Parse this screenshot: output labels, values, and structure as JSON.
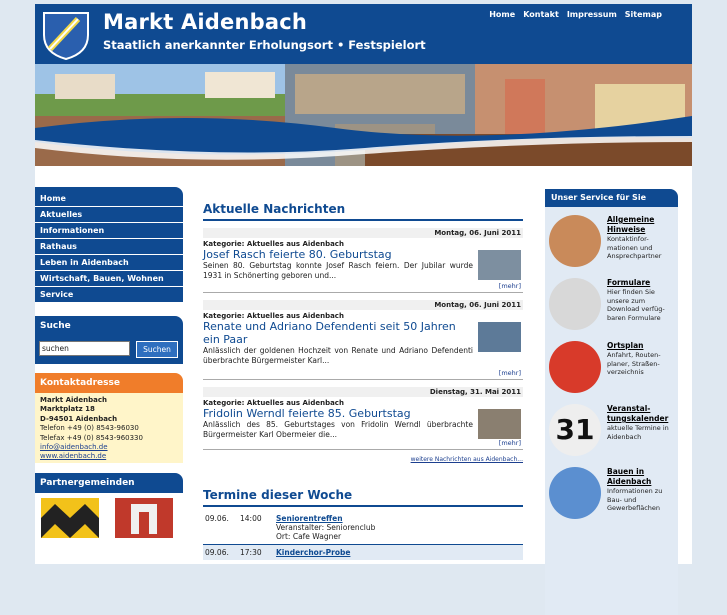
{
  "header": {
    "title": "Markt Aidenbach",
    "subtitle": "Staatlich anerkannter Erholungsort • Festspielort",
    "nav": [
      "Home",
      "Kontakt",
      "Impressum",
      "Sitemap"
    ]
  },
  "menu": [
    "Home",
    "Aktuelles",
    "Informationen",
    "Rathaus",
    "Leben in Aidenbach",
    "Wirtschaft, Bauen, Wohnen",
    "Service"
  ],
  "search": {
    "title": "Suche",
    "value": "suchen",
    "button": "Suchen"
  },
  "contact": {
    "title": "Kontaktadresse",
    "lines": [
      "Markt Aidenbach",
      "Marktplatz 18",
      "D-94501 Aidenbach",
      "Telefon +49 (0) 8543-96030",
      "Telefax +49 (0) 8543-960330"
    ],
    "email": "info@aidenbach.de",
    "web": "www.aidenbach.de"
  },
  "partner": {
    "title": "Partnergemeinden"
  },
  "news": {
    "section_title": "Aktuelle Nachrichten",
    "items": [
      {
        "date": "Montag, 06. Juni 2011",
        "category": "Kategorie: Aktuelles aus Aidenbach",
        "title": "Josef Rasch feierte 80. Geburtstag",
        "text": "Seinen 80. Geburtstag konnte Josef Rasch feiern. Der Jubilar wurde 1931 in Schönerting geboren und...",
        "more": "[mehr]"
      },
      {
        "date": "Montag, 06. Juni 2011",
        "category": "Kategorie: Aktuelles aus Aidenbach",
        "title": "Renate und Adriano Defendenti seit 50 Jahren ein Paar",
        "text": "Anlässlich der goldenen Hochzeit von Renate und Adriano Defendenti überbrachte Bürgermeister Karl...",
        "more": "[mehr]"
      },
      {
        "date": "Dienstag, 31. Mai 2011",
        "category": "Kategorie: Aktuelles aus Aidenbach",
        "title": "Fridolin Werndl feierte 85. Geburtstag",
        "text": "Anlässlich des 85. Geburtstages von Fridolin Werndl überbrachte Bürgermeister Karl Obermeier die...",
        "more": "[mehr]"
      }
    ],
    "more_link": "weitere Nachrichten aus Aidenbach..."
  },
  "events": {
    "section_title": "Termine dieser Woche",
    "items": [
      {
        "date": "09.06.",
        "time": "14:00",
        "title": "Seniorentreffen",
        "organizer": "Veranstalter: Seniorenclub",
        "place": "Ort: Cafe Wagner"
      },
      {
        "date": "09.06.",
        "time": "17:30",
        "title": "Kinderchor-Probe"
      }
    ]
  },
  "service": {
    "title": "Unser Service für Sie",
    "items": [
      {
        "title": "Allgemeine Hinweise",
        "desc": "Kontaktinfor-mationen und Ansprechpartner",
        "color": "#c98a5a"
      },
      {
        "title": "Formulare",
        "desc": "Hier finden Sie unsere zum Download verfüg-baren Formulare",
        "color": "#d8d8d8"
      },
      {
        "title": "Ortsplan",
        "desc": "Anfahrt, Routen-planer, Straßen-verzeichnis",
        "color": "#d83a2a"
      },
      {
        "title": "Veranstal-tungskalender",
        "desc": "aktuelle Termine in Aidenbach",
        "color": "#444444"
      },
      {
        "title": "Bauen in Aidenbach",
        "desc": "Informationen zu Bau- und Gewerbeflächen",
        "color": "#5b8fd0"
      }
    ]
  },
  "colors": {
    "brand": "#0f4a91",
    "accent": "#f07d2a",
    "background": "#dfe8f1"
  }
}
